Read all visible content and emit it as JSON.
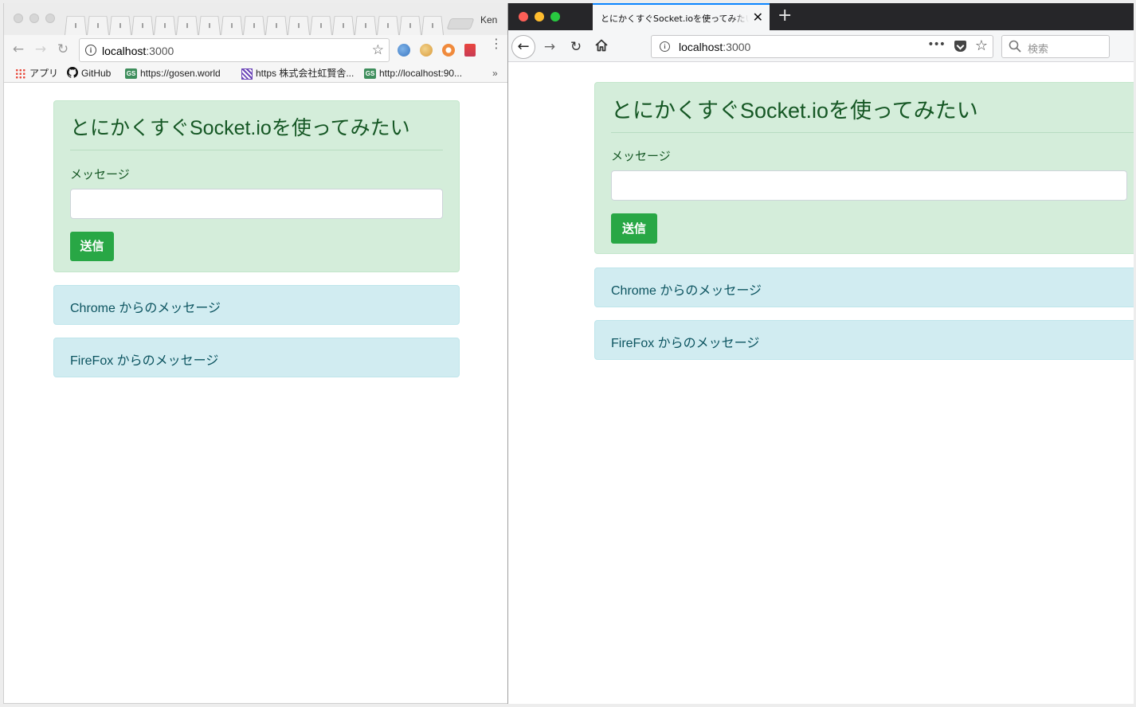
{
  "chrome_window": {
    "profile_name": "Ken",
    "omnibox": {
      "host": "localhost",
      "port": ":3000"
    },
    "bookmarks": [
      {
        "icon": "apps-grid-icon",
        "label": "アプリ"
      },
      {
        "icon": "github-icon",
        "label": "GitHub"
      },
      {
        "icon": "gs-badge-icon",
        "badge": "GS",
        "label": "https://gosen.world"
      },
      {
        "icon": "striped-square-icon",
        "label": "https 株式会社虹賢舎..."
      },
      {
        "icon": "gs-badge-icon",
        "badge": "GS",
        "label": "http://localhost:90..."
      }
    ],
    "bookmarks_overflow": "»"
  },
  "firefox_window": {
    "tab_title": "とにかくすぐSocket.ioを使ってみたい",
    "urlbar": {
      "host": "localhost",
      "port": ":3000"
    },
    "search_placeholder": "検索"
  },
  "page": {
    "title": "とにかくすぐSocket.ioを使ってみたい",
    "message_label": "メッセージ",
    "message_value": "",
    "send_label": "送信",
    "messages": [
      "Chrome からのメッセージ",
      "FireFox からのメッセージ"
    ]
  },
  "colors": {
    "jumbotron_bg": "#d4edda",
    "jumbotron_text": "#155724",
    "send_button": "#28a745",
    "alert_bg": "#d1ecf1",
    "alert_text": "#0c5460",
    "firefox_tab_accent": "#0a84ff"
  }
}
